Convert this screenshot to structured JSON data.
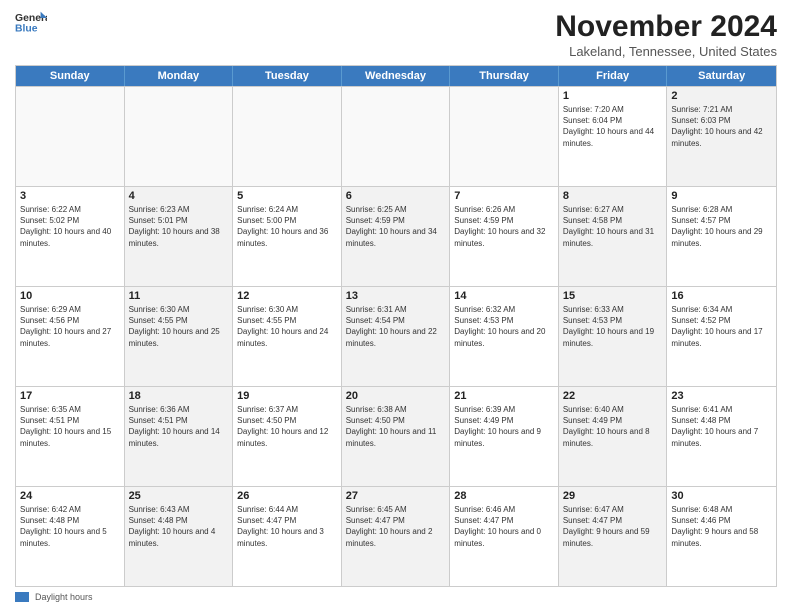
{
  "header": {
    "logo_line1": "General",
    "logo_line2": "Blue",
    "month": "November 2024",
    "location": "Lakeland, Tennessee, United States"
  },
  "weekdays": [
    "Sunday",
    "Monday",
    "Tuesday",
    "Wednesday",
    "Thursday",
    "Friday",
    "Saturday"
  ],
  "rows": [
    [
      {
        "day": "",
        "info": "",
        "empty": true
      },
      {
        "day": "",
        "info": "",
        "empty": true
      },
      {
        "day": "",
        "info": "",
        "empty": true
      },
      {
        "day": "",
        "info": "",
        "empty": true
      },
      {
        "day": "",
        "info": "",
        "empty": true
      },
      {
        "day": "1",
        "info": "Sunrise: 7:20 AM\nSunset: 6:04 PM\nDaylight: 10 hours and 44 minutes.",
        "empty": false,
        "alt": false
      },
      {
        "day": "2",
        "info": "Sunrise: 7:21 AM\nSunset: 6:03 PM\nDaylight: 10 hours and 42 minutes.",
        "empty": false,
        "alt": true
      }
    ],
    [
      {
        "day": "3",
        "info": "Sunrise: 6:22 AM\nSunset: 5:02 PM\nDaylight: 10 hours and 40 minutes.",
        "empty": false,
        "alt": false
      },
      {
        "day": "4",
        "info": "Sunrise: 6:23 AM\nSunset: 5:01 PM\nDaylight: 10 hours and 38 minutes.",
        "empty": false,
        "alt": true
      },
      {
        "day": "5",
        "info": "Sunrise: 6:24 AM\nSunset: 5:00 PM\nDaylight: 10 hours and 36 minutes.",
        "empty": false,
        "alt": false
      },
      {
        "day": "6",
        "info": "Sunrise: 6:25 AM\nSunset: 4:59 PM\nDaylight: 10 hours and 34 minutes.",
        "empty": false,
        "alt": true
      },
      {
        "day": "7",
        "info": "Sunrise: 6:26 AM\nSunset: 4:59 PM\nDaylight: 10 hours and 32 minutes.",
        "empty": false,
        "alt": false
      },
      {
        "day": "8",
        "info": "Sunrise: 6:27 AM\nSunset: 4:58 PM\nDaylight: 10 hours and 31 minutes.",
        "empty": false,
        "alt": true
      },
      {
        "day": "9",
        "info": "Sunrise: 6:28 AM\nSunset: 4:57 PM\nDaylight: 10 hours and 29 minutes.",
        "empty": false,
        "alt": false
      }
    ],
    [
      {
        "day": "10",
        "info": "Sunrise: 6:29 AM\nSunset: 4:56 PM\nDaylight: 10 hours and 27 minutes.",
        "empty": false,
        "alt": false
      },
      {
        "day": "11",
        "info": "Sunrise: 6:30 AM\nSunset: 4:55 PM\nDaylight: 10 hours and 25 minutes.",
        "empty": false,
        "alt": true
      },
      {
        "day": "12",
        "info": "Sunrise: 6:30 AM\nSunset: 4:55 PM\nDaylight: 10 hours and 24 minutes.",
        "empty": false,
        "alt": false
      },
      {
        "day": "13",
        "info": "Sunrise: 6:31 AM\nSunset: 4:54 PM\nDaylight: 10 hours and 22 minutes.",
        "empty": false,
        "alt": true
      },
      {
        "day": "14",
        "info": "Sunrise: 6:32 AM\nSunset: 4:53 PM\nDaylight: 10 hours and 20 minutes.",
        "empty": false,
        "alt": false
      },
      {
        "day": "15",
        "info": "Sunrise: 6:33 AM\nSunset: 4:53 PM\nDaylight: 10 hours and 19 minutes.",
        "empty": false,
        "alt": true
      },
      {
        "day": "16",
        "info": "Sunrise: 6:34 AM\nSunset: 4:52 PM\nDaylight: 10 hours and 17 minutes.",
        "empty": false,
        "alt": false
      }
    ],
    [
      {
        "day": "17",
        "info": "Sunrise: 6:35 AM\nSunset: 4:51 PM\nDaylight: 10 hours and 15 minutes.",
        "empty": false,
        "alt": false
      },
      {
        "day": "18",
        "info": "Sunrise: 6:36 AM\nSunset: 4:51 PM\nDaylight: 10 hours and 14 minutes.",
        "empty": false,
        "alt": true
      },
      {
        "day": "19",
        "info": "Sunrise: 6:37 AM\nSunset: 4:50 PM\nDaylight: 10 hours and 12 minutes.",
        "empty": false,
        "alt": false
      },
      {
        "day": "20",
        "info": "Sunrise: 6:38 AM\nSunset: 4:50 PM\nDaylight: 10 hours and 11 minutes.",
        "empty": false,
        "alt": true
      },
      {
        "day": "21",
        "info": "Sunrise: 6:39 AM\nSunset: 4:49 PM\nDaylight: 10 hours and 9 minutes.",
        "empty": false,
        "alt": false
      },
      {
        "day": "22",
        "info": "Sunrise: 6:40 AM\nSunset: 4:49 PM\nDaylight: 10 hours and 8 minutes.",
        "empty": false,
        "alt": true
      },
      {
        "day": "23",
        "info": "Sunrise: 6:41 AM\nSunset: 4:48 PM\nDaylight: 10 hours and 7 minutes.",
        "empty": false,
        "alt": false
      }
    ],
    [
      {
        "day": "24",
        "info": "Sunrise: 6:42 AM\nSunset: 4:48 PM\nDaylight: 10 hours and 5 minutes.",
        "empty": false,
        "alt": false
      },
      {
        "day": "25",
        "info": "Sunrise: 6:43 AM\nSunset: 4:48 PM\nDaylight: 10 hours and 4 minutes.",
        "empty": false,
        "alt": true
      },
      {
        "day": "26",
        "info": "Sunrise: 6:44 AM\nSunset: 4:47 PM\nDaylight: 10 hours and 3 minutes.",
        "empty": false,
        "alt": false
      },
      {
        "day": "27",
        "info": "Sunrise: 6:45 AM\nSunset: 4:47 PM\nDaylight: 10 hours and 2 minutes.",
        "empty": false,
        "alt": true
      },
      {
        "day": "28",
        "info": "Sunrise: 6:46 AM\nSunset: 4:47 PM\nDaylight: 10 hours and 0 minutes.",
        "empty": false,
        "alt": false
      },
      {
        "day": "29",
        "info": "Sunrise: 6:47 AM\nSunset: 4:47 PM\nDaylight: 9 hours and 59 minutes.",
        "empty": false,
        "alt": true
      },
      {
        "day": "30",
        "info": "Sunrise: 6:48 AM\nSunset: 4:46 PM\nDaylight: 9 hours and 58 minutes.",
        "empty": false,
        "alt": false
      }
    ]
  ],
  "legend": {
    "label": "Daylight hours"
  }
}
